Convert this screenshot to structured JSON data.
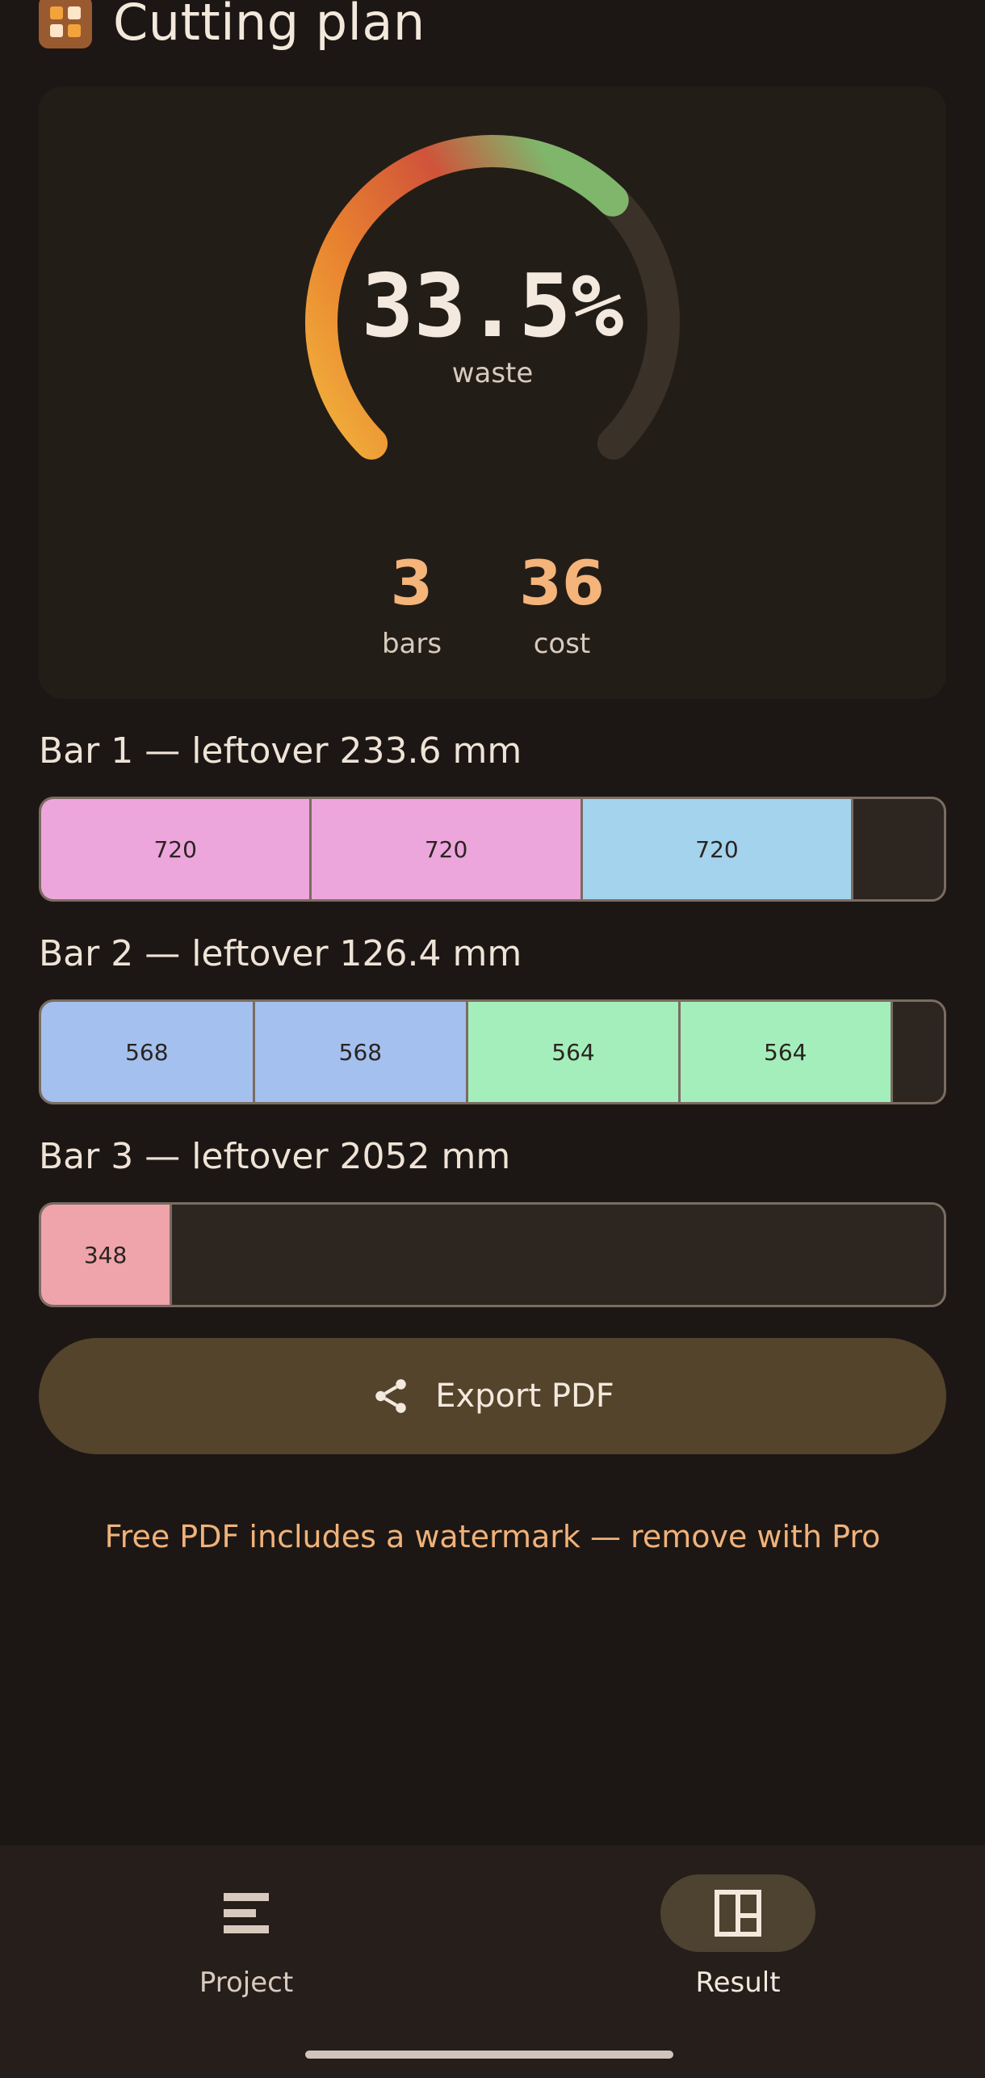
{
  "header": {
    "title": "Cutting plan",
    "icon": "grid-app-icon"
  },
  "summary": {
    "waste_percent": "33.5%",
    "waste_fraction": 0.665,
    "waste_label": "waste",
    "bars_value": "3",
    "bars_label": "bars",
    "cost_value": "36",
    "cost_label": "cost",
    "gauge_colors": [
      "#f2b23c",
      "#e8812f",
      "#d0533a",
      "#7fb66c"
    ]
  },
  "bars": [
    {
      "title": "Bar 1 — leftover 233.6 mm",
      "stock_length": 2400,
      "segments": [
        {
          "label": "720",
          "length": 720,
          "color": "#eda6dc"
        },
        {
          "label": "720",
          "length": 720,
          "color": "#eda6dc"
        },
        {
          "label": "720",
          "length": 720,
          "color": "#a4d3ee"
        }
      ]
    },
    {
      "title": "Bar 2 — leftover 126.4 mm",
      "stock_length": 2400,
      "segments": [
        {
          "label": "568",
          "length": 568,
          "color": "#a4c0ee"
        },
        {
          "label": "568",
          "length": 568,
          "color": "#a4c0ee"
        },
        {
          "label": "564",
          "length": 564,
          "color": "#a4eebb"
        },
        {
          "label": "564",
          "length": 564,
          "color": "#a4eebb"
        }
      ]
    },
    {
      "title": "Bar 3 — leftover 2052 mm",
      "stock_length": 2400,
      "segments": [
        {
          "label": "348",
          "length": 348,
          "color": "#eea4aa"
        }
      ]
    }
  ],
  "export": {
    "label": "Export PDF",
    "icon": "share-icon"
  },
  "note": "Free PDF includes a watermark — remove with Pro",
  "nav": [
    {
      "label": "Project",
      "icon": "list-icon",
      "active": false
    },
    {
      "label": "Result",
      "icon": "layout-grid-icon",
      "active": true
    }
  ]
}
